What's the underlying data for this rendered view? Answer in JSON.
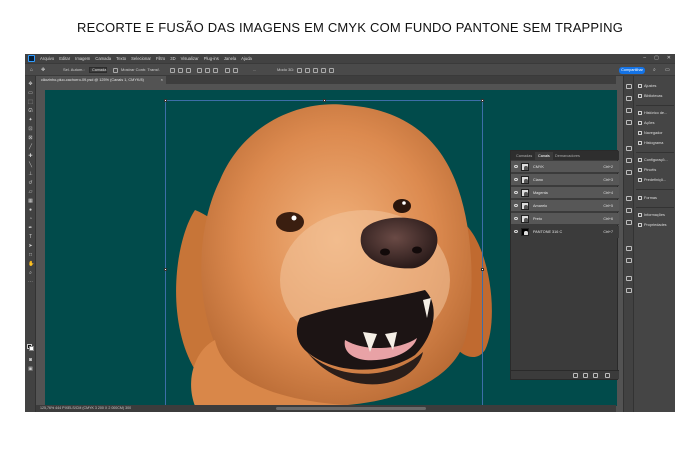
{
  "caption": "RECORTE E FUSÃO DAS IMAGENS EM CMYK COM FUNDO PANTONE SEM TRAPPING",
  "menu": [
    "Arquivo",
    "Editar",
    "Imagem",
    "Camada",
    "Texto",
    "Selecionar",
    "Filtro",
    "3D",
    "Visualizar",
    "Plug-ins",
    "Janela",
    "Ajuda"
  ],
  "options": {
    "auto_select": "Sel. Autom.:",
    "auto_select_value": "Camada",
    "transform_controls": "Mostrar Contr. Transf.",
    "mode_3d": "Modo 3D:",
    "more": "...",
    "share": "Compartilhar"
  },
  "document": {
    "tab_title": "cãozinho-pluo-cachorro-09.psd @ 125% (Canais 1, CMYK/8)",
    "close": "×",
    "status": "125,76%   444 PIXELS/CM (CMYK 3 200 X 2 000CM) 300"
  },
  "right_panel": {
    "items": [
      {
        "label": "Ajustes"
      },
      {
        "label": "Bibliotecas"
      },
      {
        "label": "Histórico de..."
      },
      {
        "label": "Ações"
      },
      {
        "label": "Navegador"
      },
      {
        "label": "Histograma"
      },
      {
        "label": "Configuraçõ..."
      },
      {
        "label": "Pincéis"
      },
      {
        "label": "Predefiniçõ..."
      },
      {
        "label": "Formas"
      },
      {
        "label": "Informações"
      },
      {
        "label": "Propriedades"
      }
    ]
  },
  "channels_panel": {
    "tabs": [
      "Camadas",
      "Canais",
      "Demarcadores"
    ],
    "active_tab": "Canais",
    "rows": [
      {
        "name": "CMYK",
        "shortcut": "Ctrl+2"
      },
      {
        "name": "Ciano",
        "shortcut": "Ctrl+3"
      },
      {
        "name": "Magenta",
        "shortcut": "Ctrl+4"
      },
      {
        "name": "Amarelo",
        "shortcut": "Ctrl+5"
      },
      {
        "name": "Preto",
        "shortcut": "Ctrl+6"
      },
      {
        "name": "PANTONE 316 C",
        "shortcut": "Ctrl+7"
      }
    ]
  },
  "colors": {
    "canvas_background": "#014b4b",
    "app_background": "#535353",
    "accent": "#1473e6"
  }
}
